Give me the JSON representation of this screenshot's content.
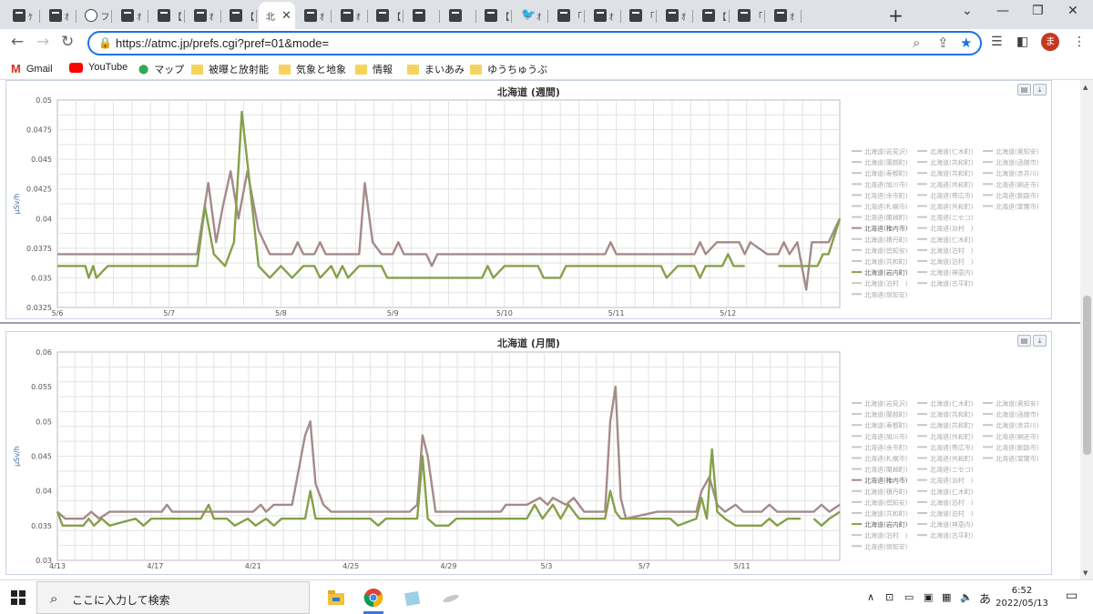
{
  "browser": {
    "tabs": [
      {
        "label": "ｹ"
      },
      {
        "label": "ｵ"
      },
      {
        "label": "フ"
      },
      {
        "label": "ｵ"
      },
      {
        "label": "【"
      },
      {
        "label": "ｵ"
      },
      {
        "label": "【"
      },
      {
        "label": "北",
        "active": true
      },
      {
        "label": "ｵ"
      },
      {
        "label": "ｵ"
      },
      {
        "label": "【"
      },
      {
        "label": ""
      },
      {
        "label": ""
      },
      {
        "label": "【"
      },
      {
        "label": "ｵ"
      },
      {
        "label": "「"
      },
      {
        "label": "ｵ"
      },
      {
        "label": "「"
      },
      {
        "label": "ｵ"
      },
      {
        "label": "【"
      },
      {
        "label": "「"
      },
      {
        "label": "ｵ"
      }
    ],
    "new_tab": "+",
    "window_controls": {
      "minimize": "⌄",
      "restore": "—",
      "maximize": "❐",
      "close": "✕"
    },
    "url": "https://atmc.jp/prefs.cgi?pref=01&mode=",
    "avatar_letter": "ま",
    "bookmarks": [
      {
        "label": "Gmail",
        "icon": "gmail-icon"
      },
      {
        "label": "YouTube",
        "icon": "youtube-icon"
      },
      {
        "label": "マップ",
        "icon": "maps-icon"
      },
      {
        "label": "被曝と放射能",
        "icon": "folder-icon"
      },
      {
        "label": "気象と地象",
        "icon": "folder-icon"
      },
      {
        "label": "情報",
        "icon": "folder-icon"
      },
      {
        "label": "まいあみ",
        "icon": "folder-icon"
      },
      {
        "label": "ゆうちゅうぶ",
        "icon": "folder-icon"
      }
    ]
  },
  "legend_items": [
    "北海道(岩見沢)",
    "北海道(仁木町)",
    "北海道(奥知安)",
    "北海道(蘭越町)",
    "北海道(共和町)",
    "北海道(函館市)",
    "北海道(寿都町)",
    "北海道(共和町)",
    "北海道(赤井川)",
    "北海道(旭川市)",
    "北海道(共和町)",
    "北海道(網走市)",
    "北海道(余市町)",
    "北海道(帯広市)",
    "北海道(釧路市)",
    "北海道(札幌市)",
    "北海道(共和町)",
    "北海道(室蘭市)",
    "北海道(蘭越町)",
    "北海道(ニセコ)",
    "北海道(稚内市)",
    "北海道(泊村　)",
    "北海道(積丹町)",
    "北海道(仁木町)",
    "北海道(倶知安)",
    "北海道(泊村　)",
    "北海道(共和町)",
    "北海道(泊村　)",
    "北海道(岩内町)",
    "北海道(神恵内)",
    "北海道(泊村　)",
    "北海道(古平町)",
    "北海道(倶知安)"
  ],
  "chart_data": [
    {
      "type": "line",
      "title": "北海道 (週間)",
      "ylabel": "µSv/h",
      "ylim": [
        0.0325,
        0.05
      ],
      "yticks": [
        "0.0325",
        "0.035",
        "0.0375",
        "0.04",
        "0.0425",
        "0.045",
        "0.0475",
        "0.05"
      ],
      "xticks": [
        "5/6",
        "5/7",
        "5/8",
        "5/9",
        "5/10",
        "5/11",
        "5/12"
      ],
      "x_range_days": [
        6.0,
        13.0
      ],
      "series": [
        {
          "color": "#a58a8a",
          "points": [
            [
              6.0,
              0.037
            ],
            [
              7.25,
              0.037
            ],
            [
              7.35,
              0.043
            ],
            [
              7.42,
              0.038
            ],
            [
              7.48,
              0.041
            ],
            [
              7.55,
              0.044
            ],
            [
              7.62,
              0.04
            ],
            [
              7.7,
              0.044
            ],
            [
              7.8,
              0.039
            ],
            [
              7.9,
              0.037
            ],
            [
              8.1,
              0.037
            ],
            [
              8.15,
              0.038
            ],
            [
              8.2,
              0.037
            ],
            [
              8.3,
              0.037
            ],
            [
              8.35,
              0.038
            ],
            [
              8.4,
              0.037
            ],
            [
              8.7,
              0.037
            ],
            [
              8.75,
              0.043
            ],
            [
              8.82,
              0.038
            ],
            [
              8.9,
              0.037
            ],
            [
              9.0,
              0.037
            ],
            [
              9.05,
              0.038
            ],
            [
              9.1,
              0.037
            ],
            [
              9.3,
              0.037
            ],
            [
              9.35,
              0.036
            ],
            [
              9.4,
              0.037
            ],
            [
              10.9,
              0.037
            ],
            [
              10.95,
              0.038
            ],
            [
              11.0,
              0.037
            ],
            [
              11.7,
              0.037
            ],
            [
              11.75,
              0.038
            ],
            [
              11.8,
              0.037
            ],
            [
              11.9,
              0.038
            ],
            [
              12.1,
              0.038
            ],
            [
              12.15,
              0.037
            ],
            [
              12.2,
              0.038
            ],
            [
              12.35,
              0.037
            ],
            [
              12.45,
              0.037
            ],
            [
              12.5,
              0.038
            ],
            [
              12.55,
              0.037
            ],
            [
              12.62,
              0.038
            ],
            [
              12.7,
              0.034
            ],
            [
              12.75,
              0.038
            ],
            [
              12.9,
              0.038
            ],
            [
              13.0,
              0.04
            ]
          ]
        },
        {
          "color": "#86a04a",
          "points": [
            [
              6.0,
              0.036
            ],
            [
              6.25,
              0.036
            ],
            [
              6.28,
              0.035
            ],
            [
              6.32,
              0.036
            ],
            [
              6.35,
              0.035
            ],
            [
              6.45,
              0.036
            ],
            [
              7.25,
              0.036
            ],
            [
              7.32,
              0.041
            ],
            [
              7.4,
              0.037
            ],
            [
              7.5,
              0.036
            ],
            [
              7.58,
              0.038
            ],
            [
              7.65,
              0.049
            ],
            [
              7.72,
              0.043
            ],
            [
              7.8,
              0.036
            ],
            [
              7.9,
              0.035
            ],
            [
              8.0,
              0.036
            ],
            [
              8.1,
              0.035
            ],
            [
              8.2,
              0.036
            ],
            [
              8.3,
              0.036
            ],
            [
              8.35,
              0.035
            ],
            [
              8.45,
              0.036
            ],
            [
              8.5,
              0.035
            ],
            [
              8.55,
              0.036
            ],
            [
              8.6,
              0.035
            ],
            [
              8.7,
              0.036
            ],
            [
              8.9,
              0.036
            ],
            [
              8.95,
              0.035
            ],
            [
              9.8,
              0.035
            ],
            [
              9.85,
              0.036
            ],
            [
              9.9,
              0.035
            ],
            [
              10.0,
              0.036
            ],
            [
              10.3,
              0.036
            ],
            [
              10.35,
              0.035
            ],
            [
              10.5,
              0.035
            ],
            [
              10.55,
              0.036
            ],
            [
              11.4,
              0.036
            ],
            [
              11.45,
              0.035
            ],
            [
              11.55,
              0.036
            ],
            [
              11.7,
              0.036
            ],
            [
              11.75,
              0.035
            ],
            [
              11.8,
              0.036
            ],
            [
              11.95,
              0.036
            ],
            [
              12.0,
              0.037
            ],
            [
              12.05,
              0.036
            ],
            [
              12.15,
              0.036
            ]
          ],
          "points_after_gap": [
            [
              12.45,
              0.036
            ],
            [
              12.7,
              0.036
            ],
            [
              12.8,
              0.036
            ],
            [
              12.85,
              0.037
            ],
            [
              12.9,
              0.037
            ],
            [
              13.0,
              0.04
            ]
          ]
        }
      ]
    },
    {
      "type": "line",
      "title": "北海道 (月間)",
      "ylabel": "µSv/h",
      "ylim": [
        0.03,
        0.06
      ],
      "yticks": [
        "0.03",
        "0.035",
        "0.04",
        "0.045",
        "0.05",
        "0.055",
        "0.06"
      ],
      "xticks": [
        "4/13",
        "4/17",
        "4/21",
        "4/25",
        "4/29",
        "5/3",
        "5/7",
        "5/11"
      ],
      "x_range_days": [
        13.0,
        43.0
      ],
      "series": [
        {
          "color": "#a58a8a",
          "points": [
            [
              13.0,
              0.037
            ],
            [
              13.3,
              0.036
            ],
            [
              14.0,
              0.036
            ],
            [
              14.3,
              0.037
            ],
            [
              14.6,
              0.036
            ],
            [
              15.0,
              0.037
            ],
            [
              17.0,
              0.037
            ],
            [
              17.2,
              0.038
            ],
            [
              17.4,
              0.037
            ],
            [
              20.5,
              0.037
            ],
            [
              20.8,
              0.038
            ],
            [
              21.0,
              0.037
            ],
            [
              21.3,
              0.038
            ],
            [
              22.0,
              0.038
            ],
            [
              22.5,
              0.048
            ],
            [
              22.7,
              0.05
            ],
            [
              22.9,
              0.041
            ],
            [
              23.2,
              0.038
            ],
            [
              23.5,
              0.037
            ],
            [
              26.5,
              0.037
            ],
            [
              26.8,
              0.038
            ],
            [
              27.0,
              0.048
            ],
            [
              27.2,
              0.045
            ],
            [
              27.5,
              0.037
            ],
            [
              30.0,
              0.037
            ],
            [
              30.2,
              0.038
            ],
            [
              31.0,
              0.038
            ],
            [
              31.5,
              0.039
            ],
            [
              31.8,
              0.038
            ],
            [
              32.0,
              0.039
            ],
            [
              32.5,
              0.038
            ],
            [
              32.8,
              0.039
            ],
            [
              33.2,
              0.037
            ],
            [
              34.0,
              0.037
            ],
            [
              34.2,
              0.05
            ],
            [
              34.4,
              0.055
            ],
            [
              34.6,
              0.039
            ],
            [
              34.8,
              0.036
            ],
            [
              36.0,
              0.037
            ],
            [
              37.5,
              0.037
            ],
            [
              37.7,
              0.04
            ],
            [
              38.0,
              0.042
            ],
            [
              38.3,
              0.038
            ],
            [
              38.6,
              0.037
            ],
            [
              39.0,
              0.038
            ],
            [
              39.3,
              0.037
            ],
            [
              40.0,
              0.037
            ],
            [
              40.3,
              0.038
            ],
            [
              40.6,
              0.037
            ],
            [
              42.0,
              0.037
            ],
            [
              42.3,
              0.038
            ],
            [
              42.6,
              0.037
            ],
            [
              43.0,
              0.038
            ]
          ]
        },
        {
          "color": "#86a04a",
          "points": [
            [
              13.0,
              0.037
            ],
            [
              13.2,
              0.035
            ],
            [
              14.0,
              0.035
            ],
            [
              14.2,
              0.036
            ],
            [
              14.4,
              0.035
            ],
            [
              14.7,
              0.036
            ],
            [
              15.0,
              0.035
            ],
            [
              16.0,
              0.036
            ],
            [
              16.3,
              0.035
            ],
            [
              16.6,
              0.036
            ],
            [
              18.5,
              0.036
            ],
            [
              18.8,
              0.038
            ],
            [
              19.0,
              0.036
            ],
            [
              19.5,
              0.036
            ],
            [
              19.8,
              0.035
            ],
            [
              20.3,
              0.036
            ],
            [
              20.6,
              0.035
            ],
            [
              21.0,
              0.036
            ],
            [
              21.3,
              0.035
            ],
            [
              21.6,
              0.036
            ],
            [
              22.5,
              0.036
            ],
            [
              22.7,
              0.04
            ],
            [
              22.9,
              0.036
            ],
            [
              25.0,
              0.036
            ],
            [
              25.3,
              0.035
            ],
            [
              25.6,
              0.036
            ],
            [
              26.8,
              0.036
            ],
            [
              27.0,
              0.045
            ],
            [
              27.2,
              0.036
            ],
            [
              27.5,
              0.035
            ],
            [
              28.0,
              0.035
            ],
            [
              28.3,
              0.036
            ],
            [
              31.0,
              0.036
            ],
            [
              31.3,
              0.038
            ],
            [
              31.6,
              0.036
            ],
            [
              32.0,
              0.038
            ],
            [
              32.3,
              0.036
            ],
            [
              32.6,
              0.038
            ],
            [
              33.0,
              0.036
            ],
            [
              34.0,
              0.036
            ],
            [
              34.2,
              0.04
            ],
            [
              34.4,
              0.037
            ],
            [
              34.6,
              0.036
            ],
            [
              36.5,
              0.036
            ],
            [
              36.8,
              0.035
            ],
            [
              37.5,
              0.036
            ],
            [
              37.7,
              0.039
            ],
            [
              37.9,
              0.036
            ],
            [
              38.1,
              0.046
            ],
            [
              38.3,
              0.037
            ],
            [
              38.6,
              0.036
            ],
            [
              39.0,
              0.035
            ],
            [
              40.0,
              0.035
            ],
            [
              40.3,
              0.036
            ],
            [
              40.6,
              0.035
            ],
            [
              41.0,
              0.036
            ],
            [
              41.5,
              0.036
            ]
          ],
          "points_after_gap": [
            [
              42.0,
              0.036
            ],
            [
              42.3,
              0.035
            ],
            [
              42.6,
              0.036
            ],
            [
              43.0,
              0.037
            ]
          ]
        }
      ]
    }
  ],
  "taskbar": {
    "search_placeholder": "ここに入力して検索",
    "ime": "あ",
    "time": "6:52",
    "date": "2022/05/13"
  }
}
